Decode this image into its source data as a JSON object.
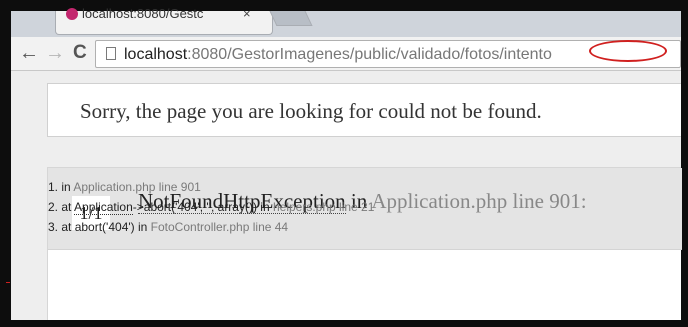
{
  "browser": {
    "tab_title": "localhost:8080/Gestc",
    "tab_close": "×",
    "icons": {
      "back": "back-arrow-icon",
      "forward": "forward-arrow-icon",
      "reload": "reload-icon",
      "page": "page-icon",
      "favicon": "laravel-favicon-icon"
    },
    "url_host": "localhost",
    "url_rest": ":8080/GestorImagenes/public/validado/fotos/intento"
  },
  "page": {
    "not_found_message": "Sorry, the page you are looking for could not be found.",
    "page_indicator": "1/1",
    "exception_class": "NotFoundHttpException",
    "exception_in": " in ",
    "exception_location": "Application.php line 901:",
    "stack_trace": [
      {
        "num": "1.",
        "pre": "in ",
        "link": "Application.php line 901",
        "args": "",
        "mid": "",
        "file": ""
      },
      {
        "num": "2.",
        "pre": "at ",
        "link": "Application",
        "args": "->abort('404', '', array()) in ",
        "mid": "",
        "file": "helpers.php line 21"
      },
      {
        "num": "3.",
        "pre": "at ",
        "link": "abort('404') in ",
        "args": "",
        "mid": "",
        "file": "FotoController.php line 44"
      }
    ]
  },
  "colors": {
    "annotation": "#d0201f",
    "muted_text": "#888888"
  }
}
